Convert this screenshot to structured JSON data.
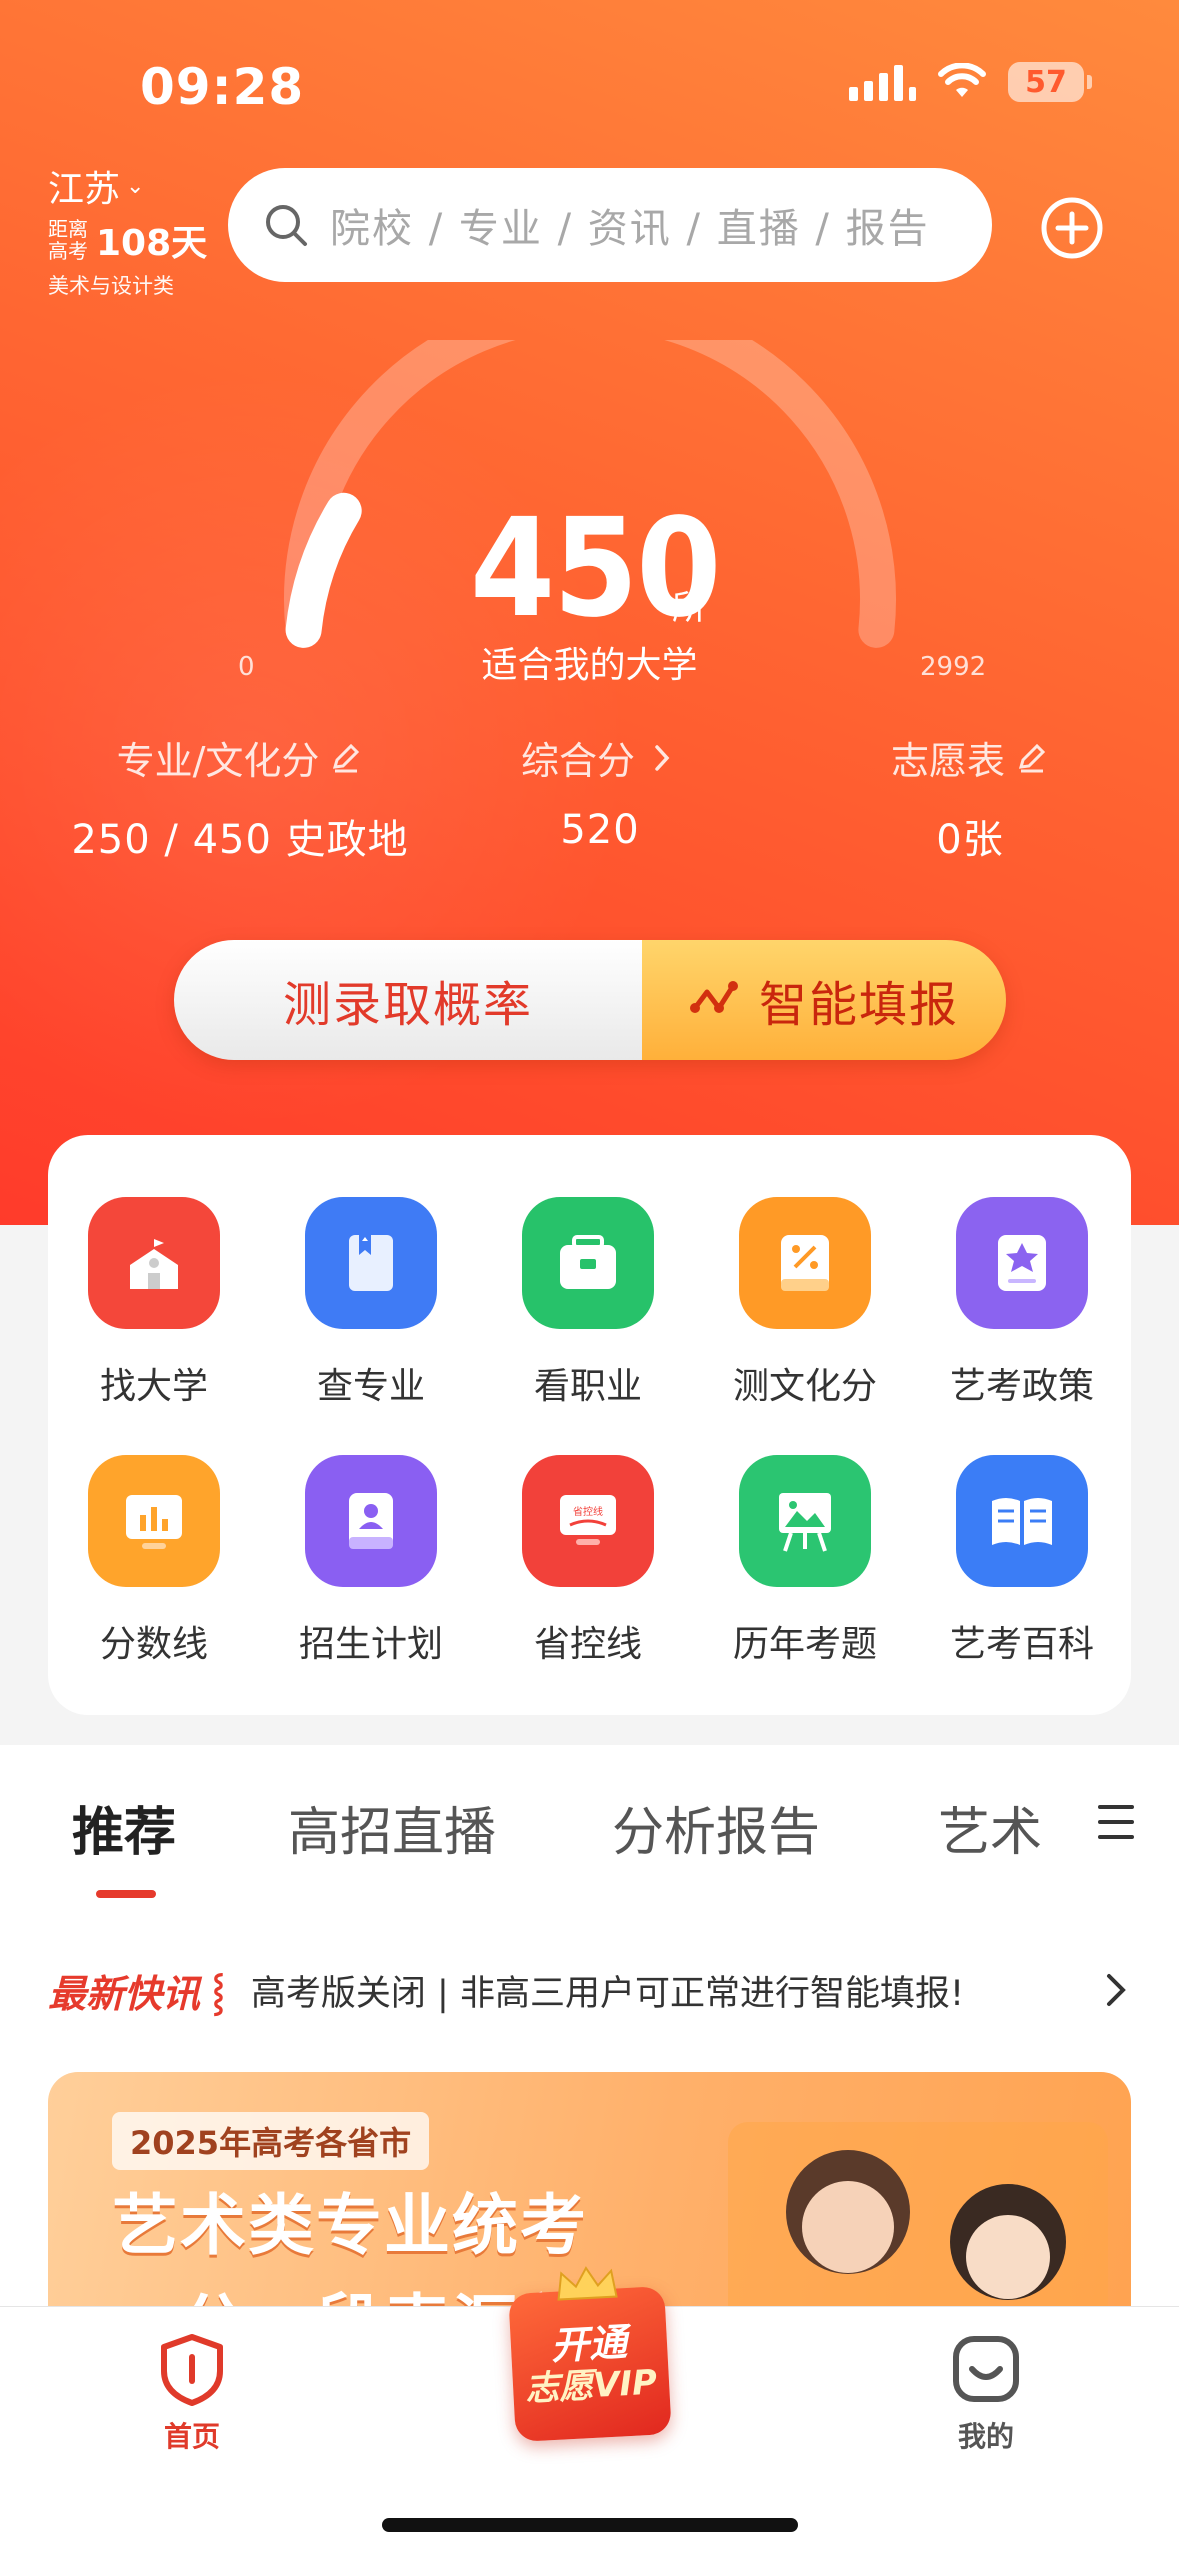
{
  "status_bar": {
    "time": "09:28",
    "battery": "57"
  },
  "header": {
    "region": "江苏",
    "countdown_prefix_line1": "距离",
    "countdown_prefix_line2": "高考",
    "countdown_days": "108天",
    "category": "美术与设计类",
    "search_placeholder": "院校 / 专业 / 资讯 / 直播 / 报告"
  },
  "gauge": {
    "value": "450",
    "unit": "所",
    "caption": "适合我的大学",
    "min": "0",
    "max": "2992",
    "fill_fraction": 0.15
  },
  "stats": [
    {
      "label": "专业/文化分",
      "value": "250 / 450 史政地",
      "icon": "edit-icon"
    },
    {
      "label": "综合分",
      "value": "520",
      "icon": "chevron-right-icon"
    },
    {
      "label": "志愿表",
      "value": "0张",
      "icon": "edit-icon"
    }
  ],
  "actions": {
    "left": "测录取概率",
    "right": "智能填报"
  },
  "grid": [
    {
      "label": "找大学",
      "icon": "school-icon",
      "color": "#f4473a"
    },
    {
      "label": "查专业",
      "icon": "book-icon",
      "color": "#3f7bf5"
    },
    {
      "label": "看职业",
      "icon": "briefcase-icon",
      "color": "#27c26a"
    },
    {
      "label": "测文化分",
      "icon": "percent-book-icon",
      "color": "#ff9a26"
    },
    {
      "label": "艺考政策",
      "icon": "star-doc-icon",
      "color": "#8b63f0"
    },
    {
      "label": "分数线",
      "icon": "bar-chart-icon",
      "color": "#ffa42b"
    },
    {
      "label": "招生计划",
      "icon": "person-doc-icon",
      "color": "#8a5ff2"
    },
    {
      "label": "省控线",
      "icon": "monitor-icon",
      "color": "#f2413a"
    },
    {
      "label": "历年考题",
      "icon": "easel-icon",
      "color": "#2bc571"
    },
    {
      "label": "艺考百科",
      "icon": "open-book-icon",
      "color": "#3b7df6"
    }
  ],
  "tabs": [
    "推荐",
    "高招直播",
    "分析报告",
    "艺术"
  ],
  "news": {
    "tag_part1": "最新",
    "tag_part2": "快讯",
    "text": "高考版关闭 | 非高三用户可正常进行智能填报!"
  },
  "banner": {
    "year_tag": "2025年高考各省市",
    "title": "艺术类专业统考",
    "subtitle": "一分一段表汇总"
  },
  "bottom_nav": {
    "home": "首页",
    "vip_line1": "开通",
    "vip_line2": "志愿VIP",
    "mine": "我的"
  }
}
